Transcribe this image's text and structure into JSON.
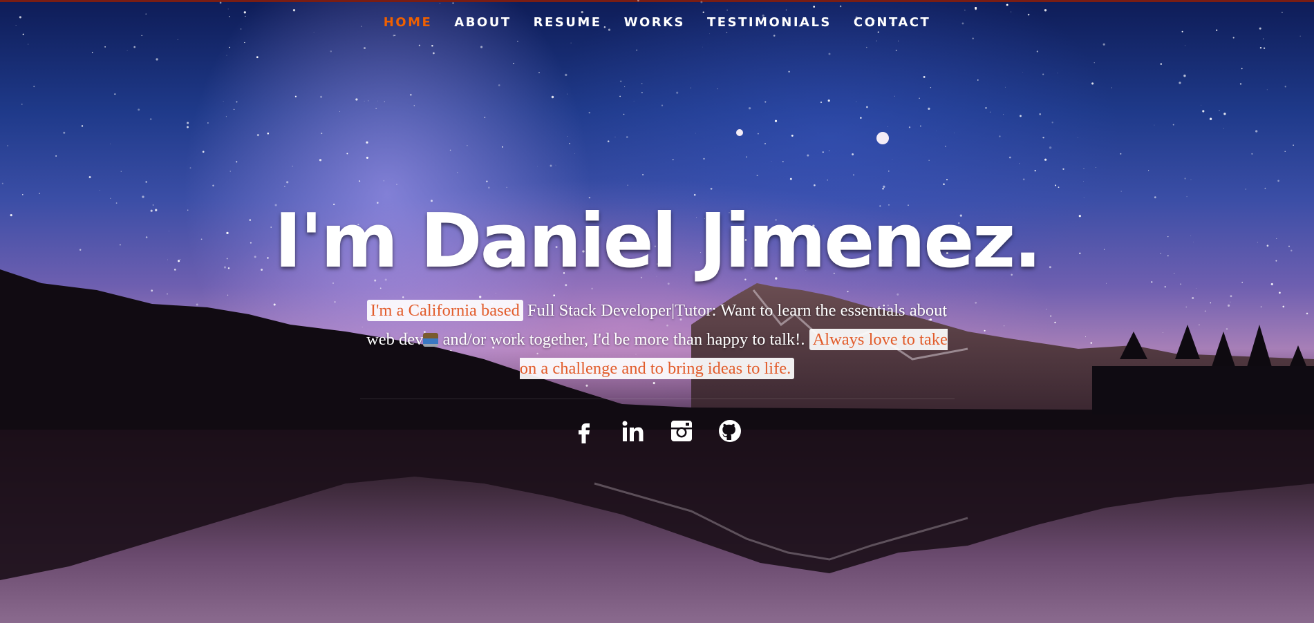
{
  "nav": {
    "items": [
      {
        "label": "HOME",
        "current": true
      },
      {
        "label": "ABOUT",
        "current": false
      },
      {
        "label": "RESUME",
        "current": false
      },
      {
        "label": "WORKS",
        "current": false
      },
      {
        "label": "TESTIMONIALS",
        "current": false
      },
      {
        "label": "CONTACT",
        "current": false
      }
    ],
    "active_color": "#F06000"
  },
  "banner": {
    "headline": "I'm Daniel Jimenez.",
    "intro": {
      "highlight_1": "I'm a California based",
      "text_1": " Full Stack Developer|Tutor: Want to learn the essentials about web dev",
      "emoji": "technologist-laptop-emoji",
      "text_2": " and/or work together, I'd be more than happy to talk!. ",
      "highlight_2": "Always love to take on a challenge and to bring ideas to life."
    },
    "highlight_color": "#e25c2b"
  },
  "social": [
    {
      "icon": "facebook-icon"
    },
    {
      "icon": "linkedin-icon"
    },
    {
      "icon": "instagram-icon"
    },
    {
      "icon": "github-icon"
    }
  ]
}
